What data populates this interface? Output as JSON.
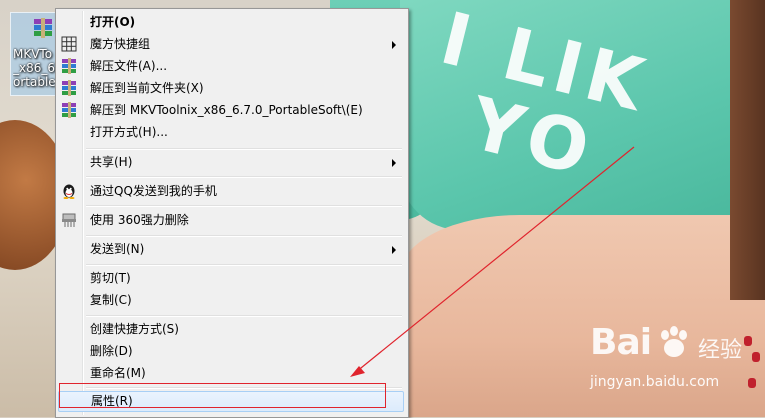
{
  "desktop_icon": {
    "label": "MKVTo\n_x86_6.7.0\nortable"
  },
  "menu": {
    "items": [
      {
        "label": "打开(O)",
        "bold": true
      },
      {
        "label": "魔方快捷组",
        "submenu": true
      },
      {
        "label": "解压文件(A)..."
      },
      {
        "label": "解压到当前文件夹(X)"
      },
      {
        "label": "解压到 MKVToolnix_x86_6.7.0_PortableSoft\\(E)"
      },
      {
        "label": "打开方式(H)..."
      },
      {
        "label": "共享(H)",
        "submenu": true
      },
      {
        "label": "通过QQ发送到我的手机"
      },
      {
        "label": "使用 360强力删除"
      },
      {
        "label": "发送到(N)",
        "submenu": true
      },
      {
        "label": "剪切(T)"
      },
      {
        "label": "复制(C)"
      },
      {
        "label": "创建快捷方式(S)"
      },
      {
        "label": "删除(D)"
      },
      {
        "label": "重命名(M)"
      },
      {
        "label": "属性(R)",
        "highlighted": true
      }
    ]
  },
  "wallpaper": {
    "shirt_text_line1": "I LIK",
    "shirt_text_line2": "YO"
  },
  "watermark": {
    "brand": "Bai",
    "brand_cn": "经验",
    "url": "jingyan.baidu.com"
  },
  "colors": {
    "menu_bg": "#f0f0f0",
    "highlight_border": "#e0242d",
    "arrow": "#e0242d",
    "hover_fill": "#dcebfc"
  }
}
